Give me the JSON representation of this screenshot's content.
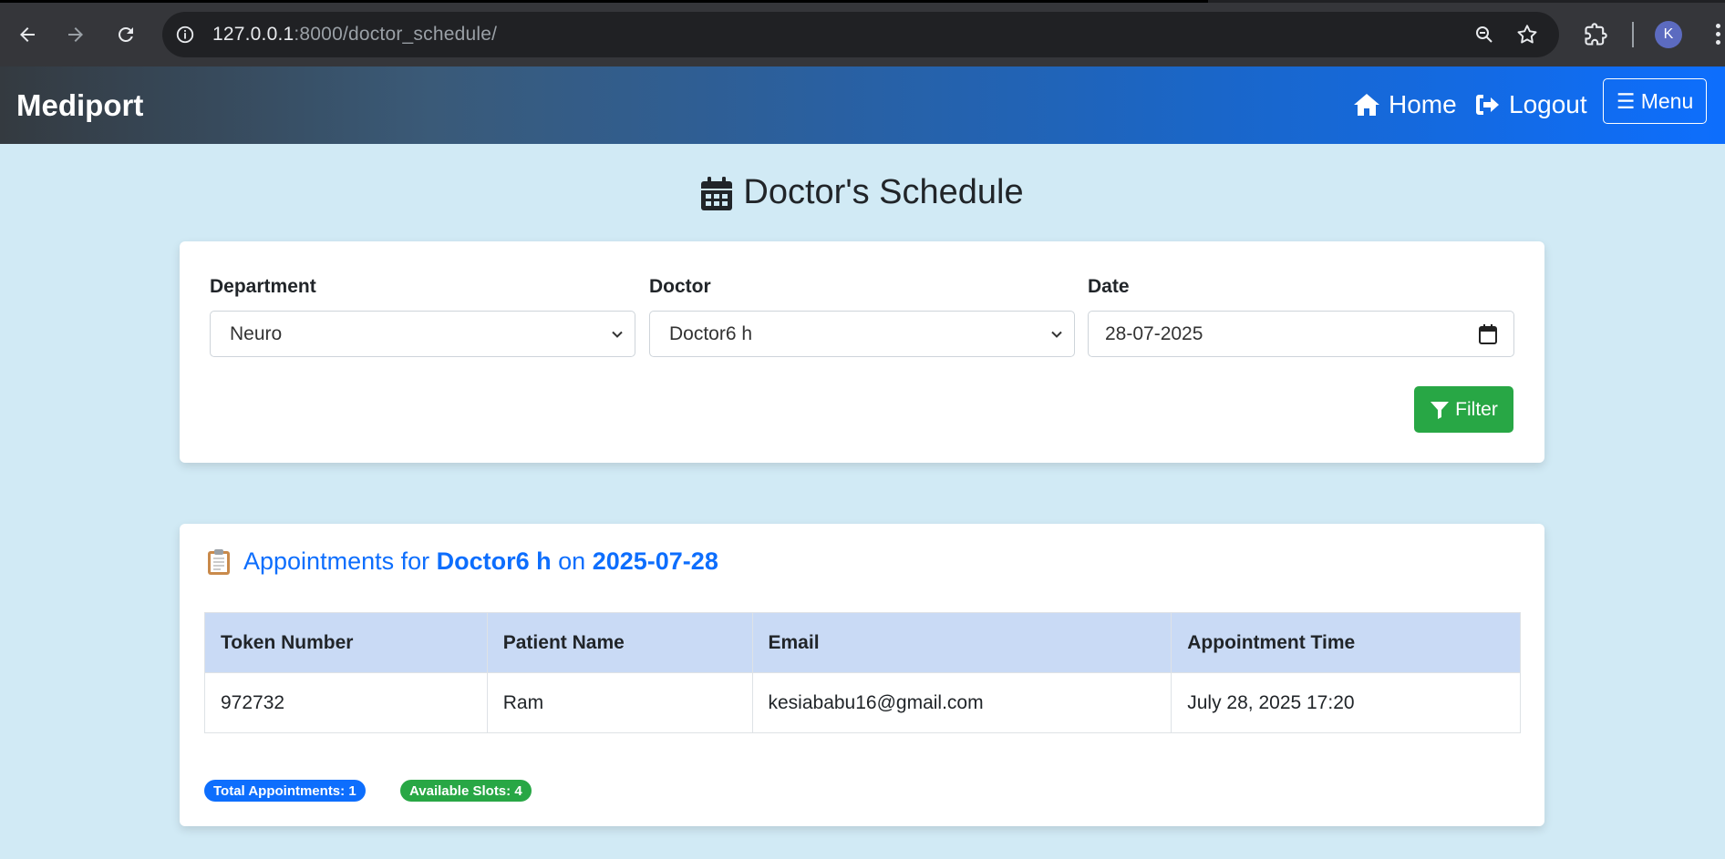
{
  "browser": {
    "url_host": "127.0.0.1",
    "url_path": ":8000/doctor_schedule/",
    "profile_initial": "K"
  },
  "navbar": {
    "brand": "Mediport",
    "home_label": "Home",
    "logout_label": "Logout",
    "menu_label": "☰ Menu"
  },
  "page": {
    "title": "Doctor's Schedule"
  },
  "filters": {
    "department_label": "Department",
    "department_value": "Neuro",
    "doctor_label": "Doctor",
    "doctor_value": "Doctor6 h",
    "date_label": "Date",
    "date_value": "28-07-2025",
    "filter_button": "Filter"
  },
  "appointments": {
    "heading_prefix": "Appointments for",
    "doctor": "Doctor6 h",
    "heading_mid": "on",
    "date": "2025-07-28",
    "columns": [
      "Token Number",
      "Patient Name",
      "Email",
      "Appointment Time"
    ],
    "rows": [
      [
        "972732",
        "Ram",
        "kesiababu16@gmail.com",
        "July 28, 2025 17:20"
      ]
    ],
    "total_badge": "Total Appointments: 1",
    "slots_badge": "Available Slots: 4"
  },
  "colors": {
    "primary": "#0d6efd",
    "success": "#28a745",
    "page_bg": "#d1eaf5",
    "table_header": "#c9daf5"
  }
}
